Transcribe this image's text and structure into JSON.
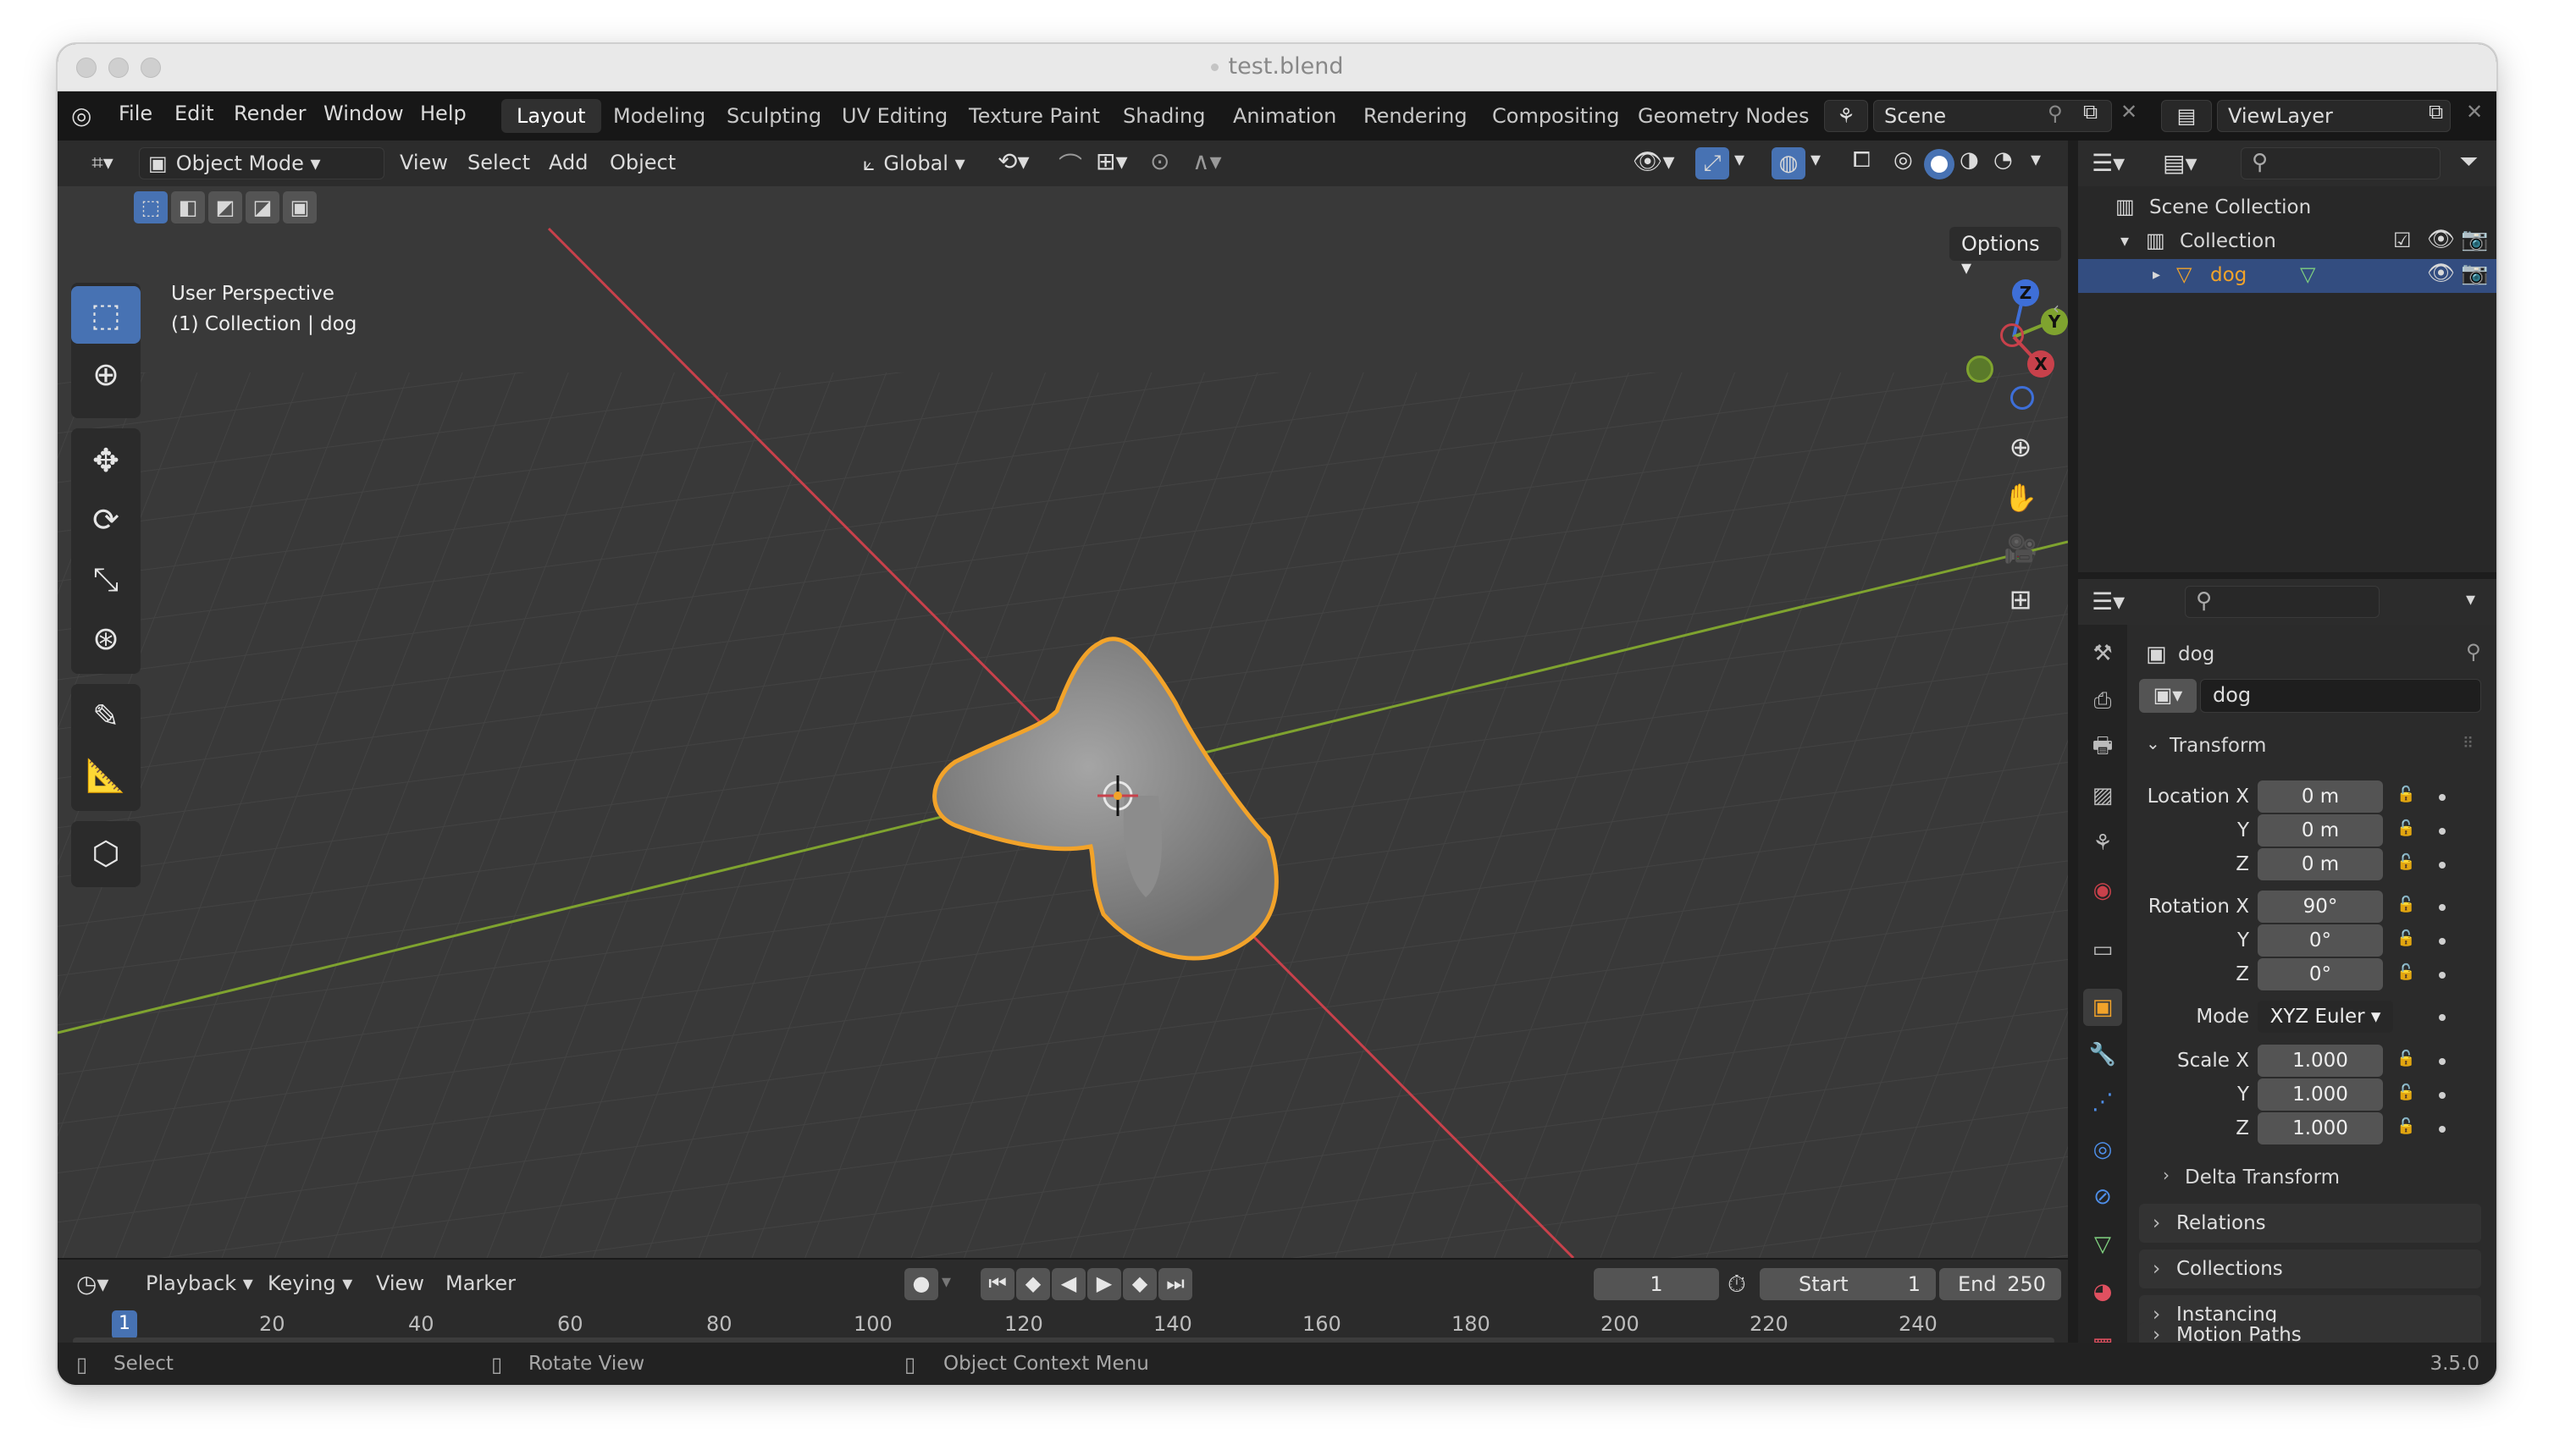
{
  "window": {
    "title": "test.blend"
  },
  "menu": {
    "items": [
      "File",
      "Edit",
      "Render",
      "Window",
      "Help"
    ]
  },
  "workspaces": [
    {
      "label": "Layout",
      "active": true
    },
    {
      "label": "Modeling"
    },
    {
      "label": "Sculpting"
    },
    {
      "label": "UV Editing"
    },
    {
      "label": "Texture Paint"
    },
    {
      "label": "Shading"
    },
    {
      "label": "Animation"
    },
    {
      "label": "Rendering"
    },
    {
      "label": "Compositing"
    },
    {
      "label": "Geometry Nodes"
    }
  ],
  "scene": {
    "name": "Scene"
  },
  "viewlayer": {
    "name": "ViewLayer"
  },
  "viewport_header": {
    "mode": "Object Mode",
    "menus": [
      "View",
      "Select",
      "Add",
      "Object"
    ],
    "transform_orientation": "Global"
  },
  "viewport": {
    "perspective_label": "User Perspective",
    "context_label": "(1) Collection | dog",
    "options_label": "Options",
    "gizmo_axes": [
      "Z",
      "Y",
      "X"
    ]
  },
  "tools": [
    "select-box",
    "cursor",
    "move",
    "rotate",
    "scale",
    "transform",
    "annotate",
    "measure",
    "add-cube"
  ],
  "outliner": {
    "items": [
      {
        "label": "Scene Collection"
      },
      {
        "label": "Collection"
      },
      {
        "label": "dog",
        "selected": true
      }
    ]
  },
  "properties": {
    "object_name": "dog",
    "datablock_name": "dog",
    "transform_header": "Transform",
    "location": {
      "label": "Location X",
      "x": "0 m",
      "y": "0 m",
      "z": "0 m"
    },
    "rotation": {
      "label": "Rotation X",
      "x": "90°",
      "y": "0°",
      "z": "0°"
    },
    "mode": {
      "label": "Mode",
      "value": "XYZ Euler"
    },
    "scale": {
      "label": "Scale X",
      "x": "1.000",
      "y": "1.000",
      "z": "1.000"
    },
    "axis_labels": {
      "y": "Y",
      "z": "Z"
    },
    "sub_panels": [
      "Delta Transform"
    ],
    "panels": [
      "Relations",
      "Collections",
      "Instancing",
      "Motion Paths"
    ]
  },
  "timeline": {
    "menus": [
      "Playback",
      "Keying",
      "View",
      "Marker"
    ],
    "current_frame": "1",
    "start_label": "Start",
    "start": "1",
    "end_label": "End",
    "end": "250",
    "ticks": [
      "1",
      "20",
      "40",
      "60",
      "80",
      "100",
      "120",
      "140",
      "160",
      "180",
      "200",
      "220",
      "240"
    ]
  },
  "statusbar": {
    "select": "Select",
    "rotate": "Rotate View",
    "context": "Object Context Menu",
    "version": "3.5.0"
  },
  "colors": {
    "accent": "#4772b3",
    "selection_outline": "#f2a32a",
    "x_axis": "#c8414b",
    "y_axis": "#7fa32f"
  }
}
